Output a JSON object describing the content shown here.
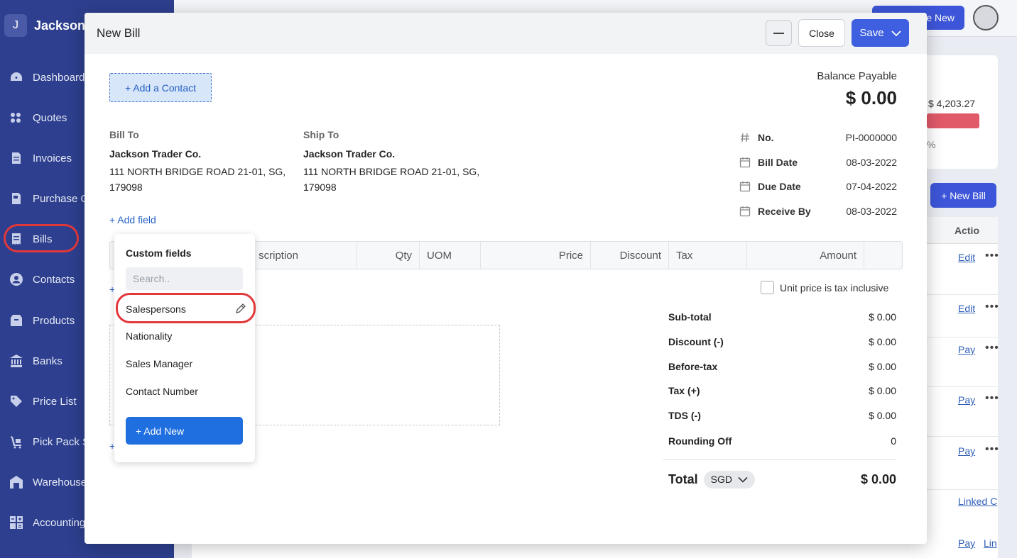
{
  "sidebar": {
    "org_initial": "J",
    "org_name": "Jackson",
    "items": [
      {
        "label": "Dashboard",
        "icon": "dashboard-icon"
      },
      {
        "label": "Quotes",
        "icon": "quote-icon"
      },
      {
        "label": "Invoices",
        "icon": "invoice-icon"
      },
      {
        "label": "Purchase O",
        "icon": "purchase-order-icon"
      },
      {
        "label": "Bills",
        "icon": "bill-icon"
      },
      {
        "label": "Contacts",
        "icon": "contact-icon"
      },
      {
        "label": "Products",
        "icon": "product-icon"
      },
      {
        "label": "Banks",
        "icon": "bank-icon"
      },
      {
        "label": "Price List",
        "icon": "tag-icon"
      },
      {
        "label": "Pick Pack S",
        "icon": "pick-pack-icon"
      },
      {
        "label": "Warehouse",
        "icon": "warehouse-icon"
      },
      {
        "label": "Accounting",
        "icon": "accounting-icon"
      }
    ]
  },
  "background": {
    "create_new": "e New",
    "amount": "$ 4,203.27",
    "pct": "%",
    "new_bill": "+ New Bill",
    "action_header": "Actio",
    "links": [
      "Edit",
      "Edit",
      "Pay",
      "Pay",
      "Pay",
      "Linked C",
      "Pay",
      "Lin"
    ]
  },
  "modal": {
    "title": "New Bill",
    "close_label": "Close",
    "save_label": "Save",
    "add_contact": "+ Add a Contact",
    "balance_label": "Balance Payable",
    "balance_value": "$ 0.00",
    "bill_to": {
      "heading": "Bill To",
      "name": "Jackson Trader Co.",
      "address": "111 NORTH BRIDGE ROAD 21-01, SG, 179098"
    },
    "ship_to": {
      "heading": "Ship To",
      "name": "Jackson Trader Co.",
      "address": "111 NORTH BRIDGE ROAD 21-01, SG, 179098"
    },
    "meta": [
      {
        "label": "No.",
        "value": "PI-0000000",
        "icon": "hash-icon"
      },
      {
        "label": "Bill Date",
        "value": "08-03-2022",
        "icon": "calendar-icon"
      },
      {
        "label": "Due Date",
        "value": "07-04-2022",
        "icon": "calendar-icon"
      },
      {
        "label": "Receive By",
        "value": "08-03-2022",
        "icon": "calendar-icon"
      }
    ],
    "add_field": "+ Add field",
    "columns": {
      "description": "scription",
      "qty": "Qty",
      "uom": "UOM",
      "price": "Price",
      "discount": "Discount",
      "tax": "Tax",
      "amount": "Amount"
    },
    "stub_plus_1": "+",
    "stub_plus_2": "+",
    "tax_inclusive_label": "Unit price is tax inclusive",
    "summary": [
      {
        "label": "Sub-total",
        "value": "$ 0.00"
      },
      {
        "label": "Discount (-)",
        "value": "$ 0.00"
      },
      {
        "label": "Before-tax",
        "value": "$ 0.00"
      },
      {
        "label": "Tax (+)",
        "value": "$ 0.00"
      },
      {
        "label": "TDS (-)",
        "value": "$ 0.00"
      },
      {
        "label": "Rounding Off",
        "value": "0"
      }
    ],
    "total_label": "Total",
    "currency": "SGD",
    "total_value": "$ 0.00"
  },
  "custom_fields": {
    "title": "Custom fields",
    "search_placeholder": "Search..",
    "items": [
      "Salespersons",
      "Nationality",
      "Sales Manager",
      "Contact Number"
    ],
    "add_new": "+ Add New"
  },
  "colors": {
    "sidebar": "#2d3f8e",
    "primary": "#3d5fe0",
    "highlight_ring": "#e2383a"
  }
}
